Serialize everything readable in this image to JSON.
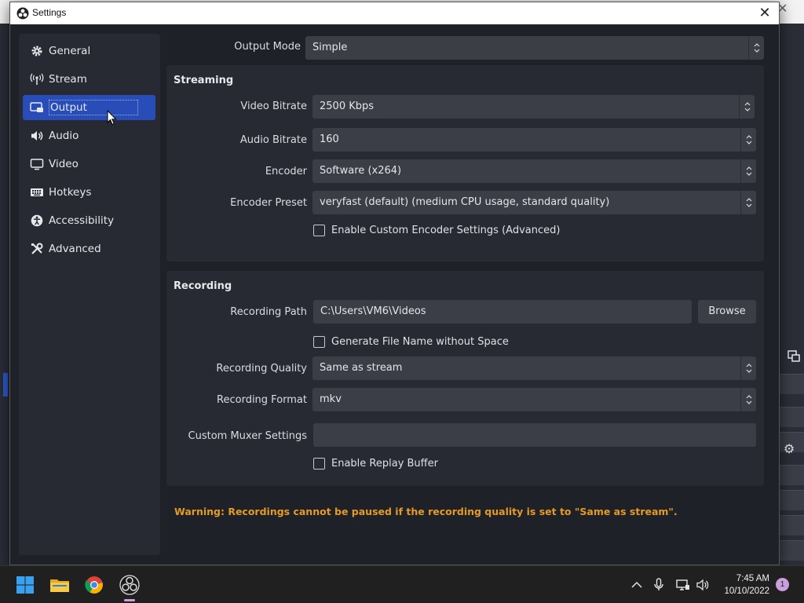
{
  "window": {
    "title": "Settings"
  },
  "sidebar": {
    "items": [
      {
        "label": "General",
        "icon": "gear-icon"
      },
      {
        "label": "Stream",
        "icon": "antenna-icon"
      },
      {
        "label": "Output",
        "icon": "output-icon",
        "active": true
      },
      {
        "label": "Audio",
        "icon": "speaker-icon"
      },
      {
        "label": "Video",
        "icon": "monitor-icon"
      },
      {
        "label": "Hotkeys",
        "icon": "keyboard-icon"
      },
      {
        "label": "Accessibility",
        "icon": "accessibility-icon"
      },
      {
        "label": "Advanced",
        "icon": "tools-icon"
      }
    ]
  },
  "output_mode": {
    "label": "Output Mode",
    "value": "Simple"
  },
  "streaming": {
    "title": "Streaming",
    "video_bitrate": {
      "label": "Video Bitrate",
      "value": "2500 Kbps"
    },
    "audio_bitrate": {
      "label": "Audio Bitrate",
      "value": "160"
    },
    "encoder": {
      "label": "Encoder",
      "value": "Software (x264)"
    },
    "encoder_preset": {
      "label": "Encoder Preset",
      "value": "veryfast (default) (medium CPU usage, standard quality)"
    },
    "custom_encoder": {
      "label": "Enable Custom Encoder Settings (Advanced)",
      "checked": false
    }
  },
  "recording": {
    "title": "Recording",
    "path": {
      "label": "Recording Path",
      "value": "C:\\Users\\VM6\\Videos",
      "browse": "Browse"
    },
    "no_space": {
      "label": "Generate File Name without Space",
      "checked": false
    },
    "quality": {
      "label": "Recording Quality",
      "value": "Same as stream"
    },
    "format": {
      "label": "Recording Format",
      "value": "mkv"
    },
    "muxer": {
      "label": "Custom Muxer Settings",
      "value": ""
    },
    "replay": {
      "label": "Enable Replay Buffer",
      "checked": false
    }
  },
  "warning": "Warning: Recordings cannot be paused if the recording quality is set to \"Same as stream\".",
  "taskbar": {
    "time": "7:45 AM",
    "date": "10/10/2022",
    "notifications": "1"
  },
  "colors": {
    "accent": "#284cb8",
    "warning": "#e59a25"
  }
}
